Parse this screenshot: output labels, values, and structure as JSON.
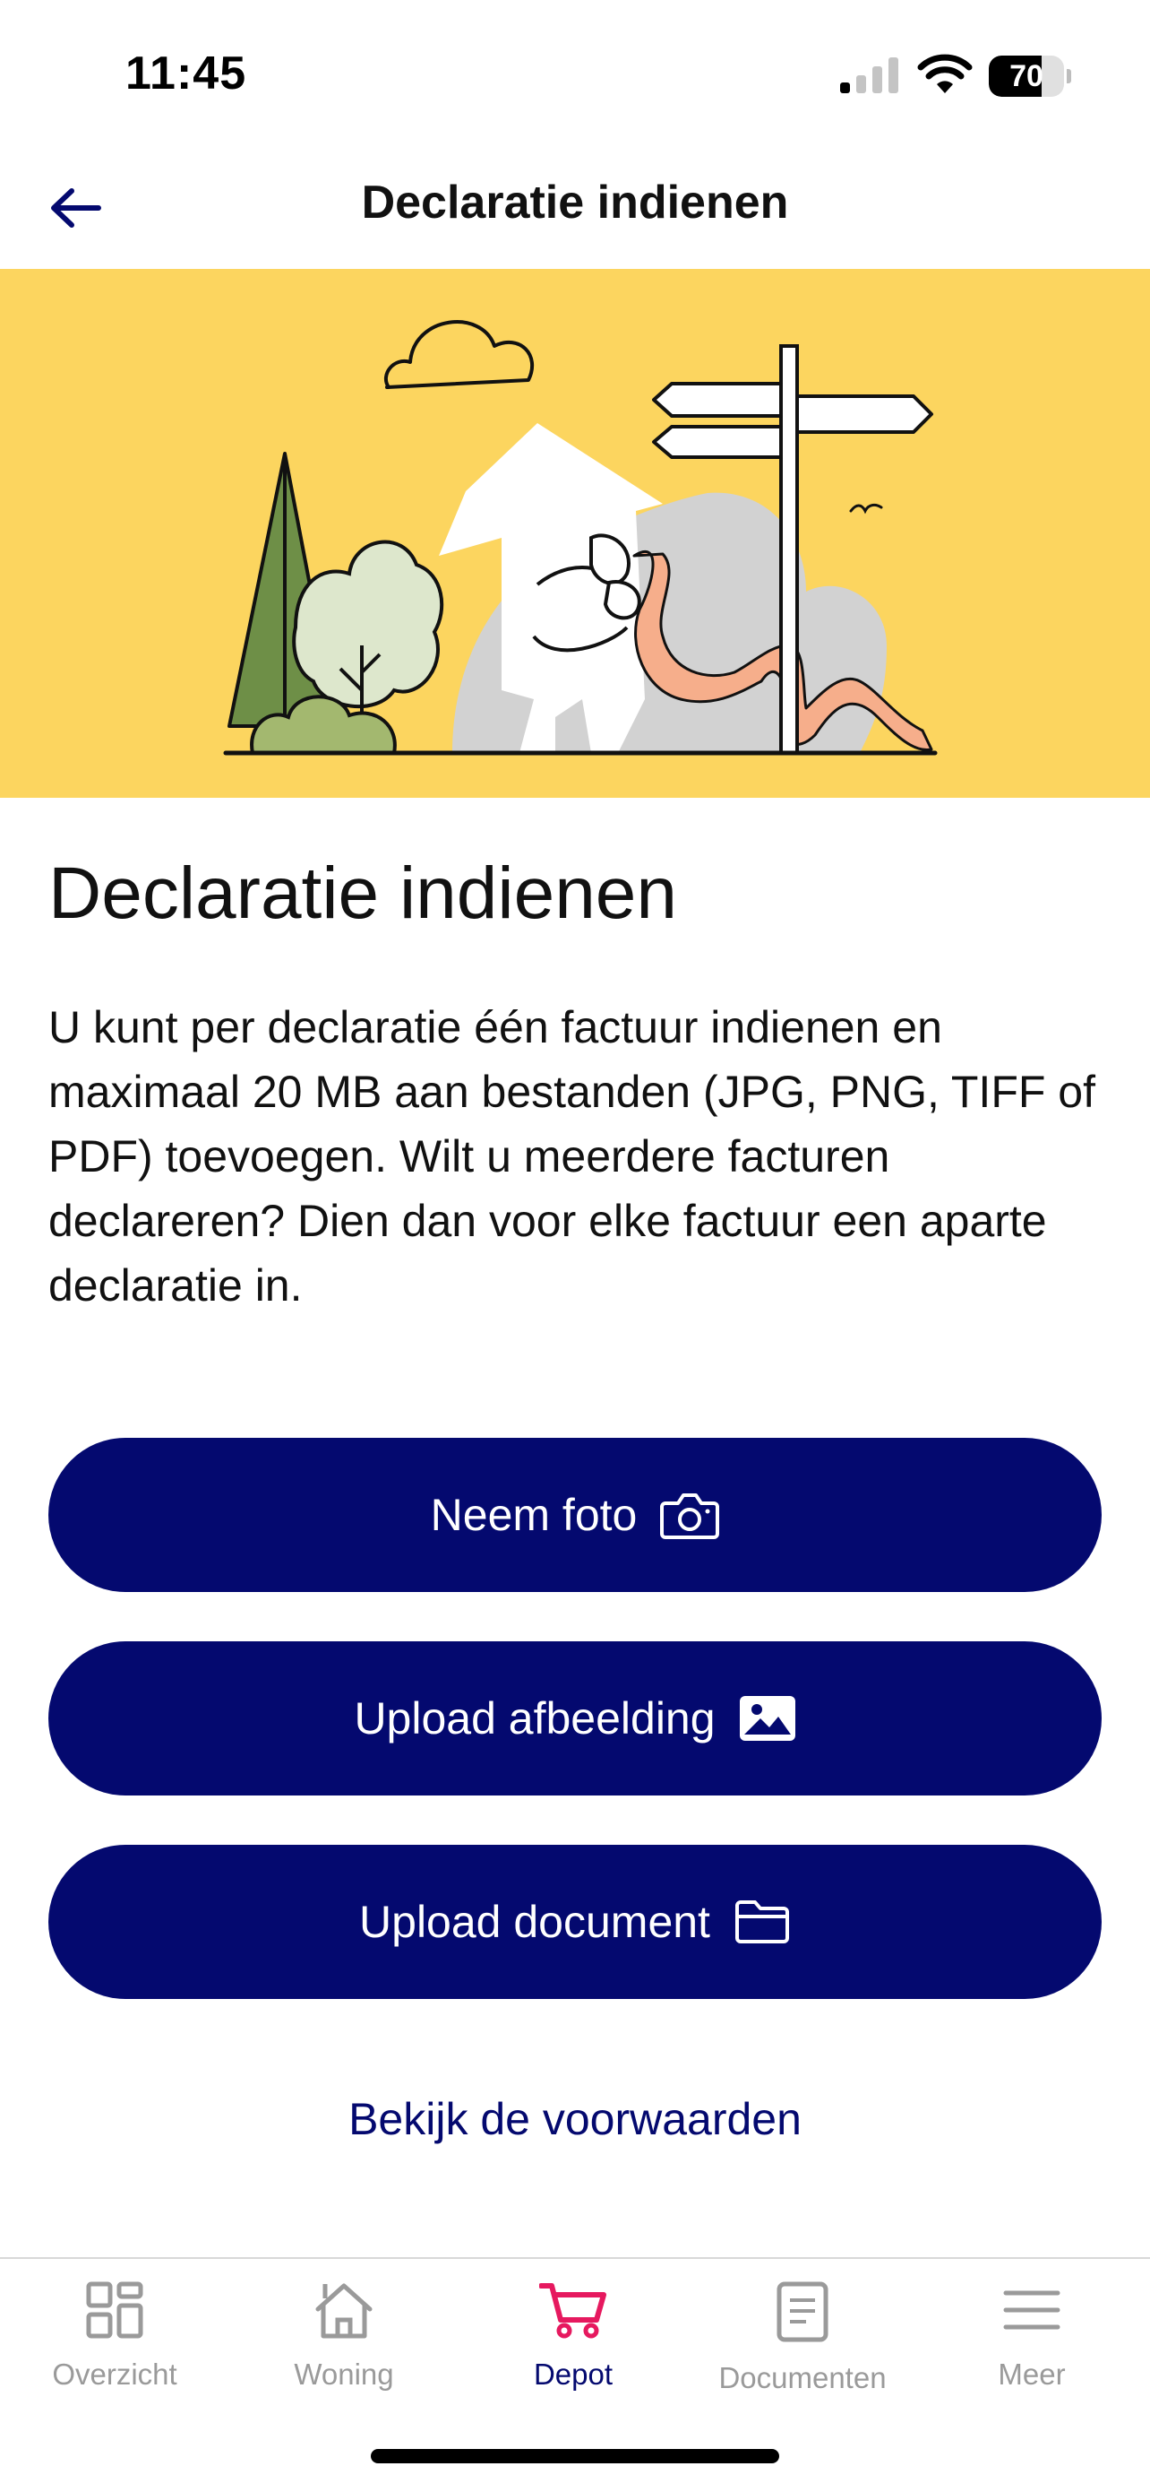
{
  "status_bar": {
    "time": "11:45",
    "battery_level": "70",
    "battery_fraction": 0.7
  },
  "header": {
    "title": "Declaratie indienen",
    "back_icon": "arrow-left-icon"
  },
  "colors": {
    "primary": "#04096f",
    "hero_background": "#fcd55f",
    "active_tab": "#e6195f",
    "inactive_tab": "#9a9a9a"
  },
  "content": {
    "title": "Declaratie indienen",
    "body": "U kunt per declaratie één factuur indienen en maximaal 20 MB aan bestanden (JPG, PNG, TIFF of PDF) toevoegen. Wilt u meerdere facturen declareren? Dien dan voor elke factuur een aparte declaratie in."
  },
  "actions": {
    "take_photo": {
      "label": "Neem foto",
      "icon": "camera-icon"
    },
    "upload_image": {
      "label": "Upload afbeelding",
      "icon": "image-icon"
    },
    "upload_document": {
      "label": "Upload document",
      "icon": "folder-icon"
    }
  },
  "terms_link": "Bekijk de voorwaarden",
  "tabbar": {
    "active": "Depot",
    "items": [
      {
        "label": "Overzicht",
        "icon": "dashboard-icon"
      },
      {
        "label": "Woning",
        "icon": "house-icon"
      },
      {
        "label": "Depot",
        "icon": "cart-icon"
      },
      {
        "label": "Documenten",
        "icon": "document-icon"
      },
      {
        "label": "Meer",
        "icon": "menu-icon"
      }
    ]
  }
}
